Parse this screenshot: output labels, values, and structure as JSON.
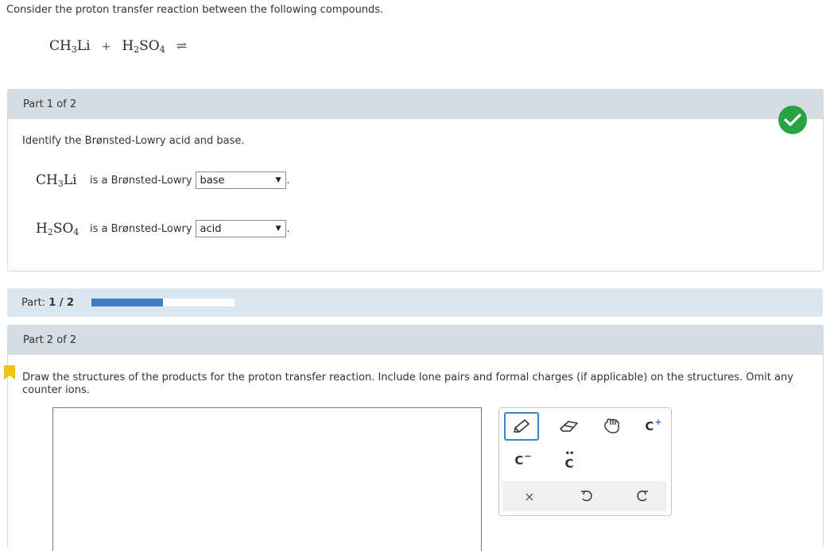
{
  "prompt": "Consider the proton transfer reaction between the following compounds.",
  "equation": {
    "reactant1": {
      "main": "CH",
      "sub": "3",
      "rest": "Li"
    },
    "plus": "+",
    "reactant2": {
      "h": "H",
      "sub1": "2",
      "mid": "SO",
      "sub2": "4"
    },
    "arrow": "⇌"
  },
  "part1": {
    "header": "Part 1 of 2",
    "instruction": "Identify the Brønsted-Lowry acid and base.",
    "row1": {
      "formula_main": "CH",
      "formula_sub": "3",
      "formula_rest": "Li",
      "phrase": "is a Brønsted-Lowry",
      "selected": "base"
    },
    "row2": {
      "formula_h": "H",
      "formula_sub1": "2",
      "formula_mid": "SO",
      "formula_sub2": "4",
      "phrase": "is a Brønsted-Lowry",
      "selected": "acid"
    },
    "period": ".",
    "status_icon": "check-icon",
    "status_color": "#27a343"
  },
  "progress": {
    "label": "Part:",
    "value_text": "1 / 2",
    "fraction": 0.5,
    "fill_color": "#3d7fc1"
  },
  "part2": {
    "header": "Part 2 of 2",
    "instruction": "Draw the structures of the products for the proton transfer reaction. Include lone pairs and formal charges (if applicable) on the structures. Omit any counter ions.",
    "bookmark_color": "#f2c217"
  },
  "tools": {
    "pencil": "pencil-icon",
    "eraser": "eraser-icon",
    "hand": "hand-icon",
    "cplus": {
      "letter": "C",
      "sup": "+"
    },
    "cminus": {
      "letter": "C",
      "sup": "−"
    },
    "clone": {
      "letter": "C",
      "dots": "••"
    },
    "clear": "×",
    "undo": "undo-icon",
    "redo": "redo-icon"
  }
}
